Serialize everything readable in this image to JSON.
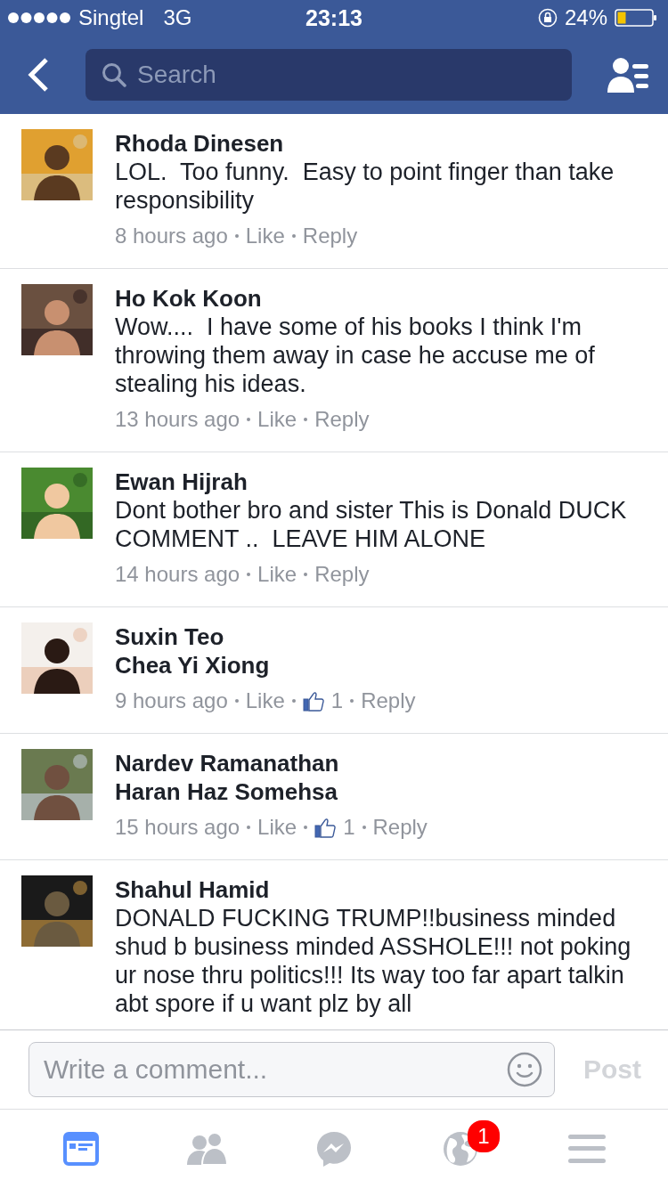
{
  "status_bar": {
    "carrier": "Singtel",
    "network": "3G",
    "time": "23:13",
    "battery": "24%"
  },
  "nav": {
    "search": {
      "placeholder": "Search"
    }
  },
  "comments": [
    {
      "author": "Rhoda Dinesen",
      "text": "LOL.  Too funny.  Easy to point finger than take responsibility",
      "time": "8 hours ago",
      "like": "Like",
      "reply": "Reply"
    },
    {
      "author": "Ho Kok Koon",
      "text": "Wow....  I have some of his books I think I'm throwing them away in case he accuse me of stealing his ideas.",
      "time": "13 hours ago",
      "like": "Like",
      "reply": "Reply"
    },
    {
      "author": "Ewan Hijrah",
      "text": "Dont bother bro and sister This is Donald DUCK COMMENT ..  LEAVE HIM ALONE",
      "time": "14 hours ago",
      "like": "Like",
      "reply": "Reply"
    },
    {
      "author": "Suxin Teo",
      "mention": "Chea Yi Xiong",
      "time": "9 hours ago",
      "like": "Like",
      "likes": "1",
      "reply": "Reply"
    },
    {
      "author": "Nardev Ramanathan",
      "mention": "Haran Haz Somehsa",
      "time": "15 hours ago",
      "like": "Like",
      "likes": "1",
      "reply": "Reply"
    },
    {
      "author": "Shahul Hamid",
      "text": "DONALD FUCKING TRUMP!!business minded shud b business minded ASSHOLE!!! not poking ur nose thru politics!!! Its way too far apart talkin abt spore if u want plz by all"
    }
  ],
  "composer": {
    "placeholder": "Write a comment...",
    "post": "Post"
  },
  "tab_bar": [
    {
      "kind": "feed",
      "selected": true
    },
    {
      "kind": "friends",
      "selected": false
    },
    {
      "kind": "messenger",
      "selected": false
    },
    {
      "kind": "globe",
      "selected": false,
      "badge": "1"
    },
    {
      "kind": "menu",
      "selected": false
    }
  ]
}
